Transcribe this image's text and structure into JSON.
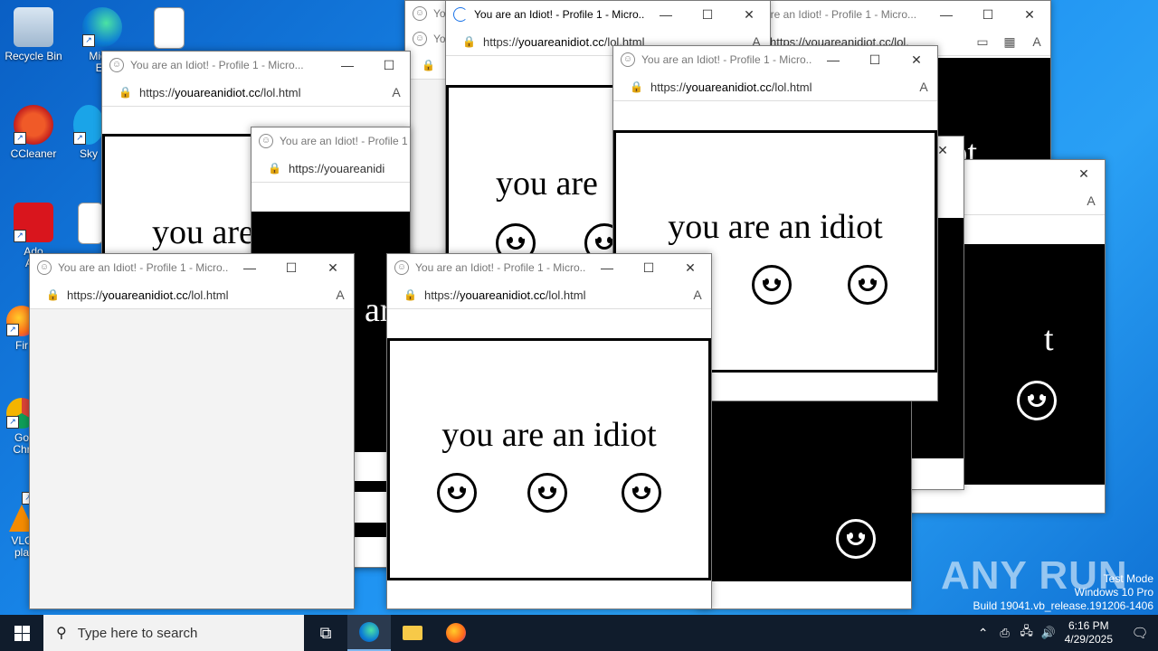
{
  "desktop": {
    "icons": [
      {
        "label": "Recycle Bin"
      },
      {
        "label": "Micro\nEd"
      },
      {
        "label": "CCleaner"
      },
      {
        "label": "Sky"
      },
      {
        "label": "Ado\nAcr"
      },
      {
        "label": "Fir"
      },
      {
        "label": "Go\nChr"
      },
      {
        "label": "VLC\npla"
      }
    ]
  },
  "windows": {
    "title": "You are an Idiot! - Profile 1 - Micro...",
    "url_prefix": "https://",
    "url_domain": "youareanidiot.cc",
    "url_path": "/lol.html",
    "page_text": "you are an idiot",
    "page_text_partial_a": "you are",
    "page_text_partial_b": "ar",
    "page_text_partial_c": "iot",
    "page_text_partial_d": "t",
    "titles_truncated": {
      "t1": "You",
      "t2": "You",
      "t3": "are an Idiot! - Profile 1 - Micro...",
      "t4": "You are an Idiot! - Profile 1 -"
    },
    "url_truncated_a": "https://youareanidi",
    "url_truncated_b": "https://youareanidiot.cc/lol."
  },
  "taskbar": {
    "search_placeholder": "Type here to search",
    "time": "6:16 PM",
    "date": "4/29/2025"
  },
  "watermark": {
    "line1": "Test Mode",
    "line2": "Windows 10 Pro",
    "line3": "Build 19041.vb_release.191206-1406",
    "brand": "ANY RUN"
  }
}
